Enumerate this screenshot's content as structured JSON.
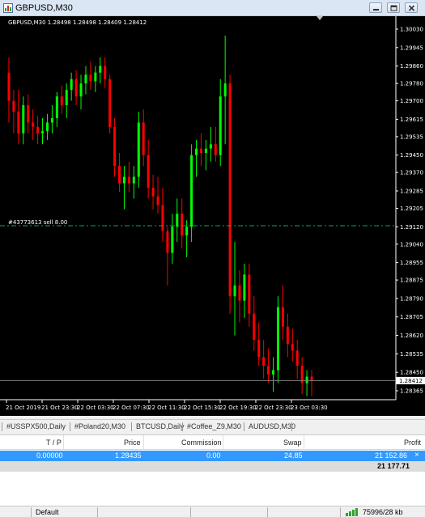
{
  "window": {
    "title": "GBPUSD,M30",
    "colors": {
      "bull": "#00ff00",
      "bear": "#ff0000",
      "background": "#000000",
      "order_line": "#00b050"
    }
  },
  "chart": {
    "info": "GBPUSD,M30  1.28498 1.28498 1.28409 1.28412",
    "order_label": "#43773613 sell 8.00",
    "current_price_label": "1.28412"
  },
  "chart_data": {
    "type": "candlestick",
    "symbol": "GBPUSD",
    "timeframe": "M30",
    "price_ticks": [
      "1.30030",
      "1.29945",
      "1.29860",
      "1.29780",
      "1.29700",
      "1.29615",
      "1.29535",
      "1.29450",
      "1.29370",
      "1.29285",
      "1.29205",
      "1.29120",
      "1.29040",
      "1.28955",
      "1.28875",
      "1.28790",
      "1.28705",
      "1.28620",
      "1.28535",
      "1.28450",
      "1.28365"
    ],
    "time_ticks": [
      "21 Oct 2019",
      "21 Oct 23:30",
      "22 Oct 03:30",
      "22 Oct 07:30",
      "22 Oct 11:30",
      "22 Oct 15:30",
      "22 Oct 19:30",
      "22 Oct 23:30",
      "23 Oct 03:30"
    ],
    "ylim": [
      1.28365,
      1.3003
    ],
    "order_price": 1.29125,
    "current_price": 1.28412,
    "candles": [
      {
        "o": 1.2983,
        "h": 1.299,
        "l": 1.296,
        "c": 1.297
      },
      {
        "o": 1.297,
        "h": 1.2975,
        "l": 1.2955,
        "c": 1.2965
      },
      {
        "o": 1.2965,
        "h": 1.2975,
        "l": 1.295,
        "c": 1.2955
      },
      {
        "o": 1.2955,
        "h": 1.2972,
        "l": 1.295,
        "c": 1.2968
      },
      {
        "o": 1.2968,
        "h": 1.2973,
        "l": 1.2955,
        "c": 1.296
      },
      {
        "o": 1.296,
        "h": 1.2966,
        "l": 1.2952,
        "c": 1.2958
      },
      {
        "o": 1.2958,
        "h": 1.2963,
        "l": 1.295,
        "c": 1.2955
      },
      {
        "o": 1.2955,
        "h": 1.2962,
        "l": 1.295,
        "c": 1.2956
      },
      {
        "o": 1.2956,
        "h": 1.2964,
        "l": 1.2952,
        "c": 1.296
      },
      {
        "o": 1.296,
        "h": 1.2968,
        "l": 1.2955,
        "c": 1.2962
      },
      {
        "o": 1.2962,
        "h": 1.2974,
        "l": 1.2958,
        "c": 1.2972
      },
      {
        "o": 1.2972,
        "h": 1.2977,
        "l": 1.2964,
        "c": 1.2968
      },
      {
        "o": 1.2968,
        "h": 1.2978,
        "l": 1.2962,
        "c": 1.2975
      },
      {
        "o": 1.2975,
        "h": 1.2983,
        "l": 1.297,
        "c": 1.298
      },
      {
        "o": 1.298,
        "h": 1.2984,
        "l": 1.2968,
        "c": 1.2972
      },
      {
        "o": 1.2972,
        "h": 1.2982,
        "l": 1.2966,
        "c": 1.2978
      },
      {
        "o": 1.2978,
        "h": 1.2986,
        "l": 1.2973,
        "c": 1.2982
      },
      {
        "o": 1.2982,
        "h": 1.2988,
        "l": 1.2975,
        "c": 1.2979
      },
      {
        "o": 1.2979,
        "h": 1.2986,
        "l": 1.2974,
        "c": 1.2983
      },
      {
        "o": 1.2983,
        "h": 1.299,
        "l": 1.2978,
        "c": 1.2986
      },
      {
        "o": 1.2986,
        "h": 1.299,
        "l": 1.2976,
        "c": 1.298
      },
      {
        "o": 1.298,
        "h": 1.2982,
        "l": 1.2955,
        "c": 1.2958
      },
      {
        "o": 1.2958,
        "h": 1.2962,
        "l": 1.2935,
        "c": 1.294
      },
      {
        "o": 1.294,
        "h": 1.2946,
        "l": 1.2928,
        "c": 1.2932
      },
      {
        "o": 1.2932,
        "h": 1.294,
        "l": 1.292,
        "c": 1.2935
      },
      {
        "o": 1.2935,
        "h": 1.2942,
        "l": 1.2928,
        "c": 1.2932
      },
      {
        "o": 1.2932,
        "h": 1.294,
        "l": 1.2925,
        "c": 1.2935
      },
      {
        "o": 1.2935,
        "h": 1.2965,
        "l": 1.293,
        "c": 1.296
      },
      {
        "o": 1.296,
        "h": 1.2966,
        "l": 1.294,
        "c": 1.2945
      },
      {
        "o": 1.2945,
        "h": 1.2952,
        "l": 1.2925,
        "c": 1.293
      },
      {
        "o": 1.293,
        "h": 1.2936,
        "l": 1.292,
        "c": 1.2926
      },
      {
        "o": 1.2926,
        "h": 1.2935,
        "l": 1.2918,
        "c": 1.2922
      },
      {
        "o": 1.2922,
        "h": 1.293,
        "l": 1.2905,
        "c": 1.291
      },
      {
        "o": 1.291,
        "h": 1.2912,
        "l": 1.2885,
        "c": 1.29
      },
      {
        "o": 1.29,
        "h": 1.2918,
        "l": 1.2895,
        "c": 1.2912
      },
      {
        "o": 1.2912,
        "h": 1.2925,
        "l": 1.2905,
        "c": 1.2918
      },
      {
        "o": 1.2918,
        "h": 1.2925,
        "l": 1.2902,
        "c": 1.2908
      },
      {
        "o": 1.2908,
        "h": 1.2915,
        "l": 1.2898,
        "c": 1.2912
      },
      {
        "o": 1.2912,
        "h": 1.295,
        "l": 1.2905,
        "c": 1.2945
      },
      {
        "o": 1.2945,
        "h": 1.2952,
        "l": 1.2935,
        "c": 1.2948
      },
      {
        "o": 1.2948,
        "h": 1.2955,
        "l": 1.294,
        "c": 1.2946
      },
      {
        "o": 1.2946,
        "h": 1.2952,
        "l": 1.2938,
        "c": 1.2948
      },
      {
        "o": 1.2948,
        "h": 1.2958,
        "l": 1.2942,
        "c": 1.295
      },
      {
        "o": 1.295,
        "h": 1.2958,
        "l": 1.2942,
        "c": 1.2945
      },
      {
        "o": 1.2945,
        "h": 1.298,
        "l": 1.294,
        "c": 1.2972
      },
      {
        "o": 1.2972,
        "h": 1.3,
        "l": 1.295,
        "c": 1.2978
      },
      {
        "o": 1.2978,
        "h": 1.2982,
        "l": 1.2872,
        "c": 1.288
      },
      {
        "o": 1.288,
        "h": 1.2905,
        "l": 1.2862,
        "c": 1.2885
      },
      {
        "o": 1.2885,
        "h": 1.2892,
        "l": 1.2868,
        "c": 1.2878
      },
      {
        "o": 1.2878,
        "h": 1.2895,
        "l": 1.287,
        "c": 1.289
      },
      {
        "o": 1.289,
        "h": 1.2895,
        "l": 1.2866,
        "c": 1.2872
      },
      {
        "o": 1.2872,
        "h": 1.288,
        "l": 1.2855,
        "c": 1.286
      },
      {
        "o": 1.286,
        "h": 1.2868,
        "l": 1.2848,
        "c": 1.2852
      },
      {
        "o": 1.2852,
        "h": 1.286,
        "l": 1.2842,
        "c": 1.2848
      },
      {
        "o": 1.2848,
        "h": 1.2856,
        "l": 1.284,
        "c": 1.2844
      },
      {
        "o": 1.2844,
        "h": 1.2852,
        "l": 1.2836,
        "c": 1.2846
      },
      {
        "o": 1.2846,
        "h": 1.288,
        "l": 1.284,
        "c": 1.2875
      },
      {
        "o": 1.2875,
        "h": 1.2885,
        "l": 1.286,
        "c": 1.2866
      },
      {
        "o": 1.2866,
        "h": 1.2872,
        "l": 1.2852,
        "c": 1.2858
      },
      {
        "o": 1.2858,
        "h": 1.2865,
        "l": 1.285,
        "c": 1.2855
      },
      {
        "o": 1.2855,
        "h": 1.286,
        "l": 1.2842,
        "c": 1.2848
      },
      {
        "o": 1.2848,
        "h": 1.2852,
        "l": 1.2835,
        "c": 1.284
      },
      {
        "o": 1.284,
        "h": 1.2846,
        "l": 1.2834,
        "c": 1.2843
      },
      {
        "o": 1.2843,
        "h": 1.2846,
        "l": 1.2834,
        "c": 1.2841
      }
    ]
  },
  "tabs": [
    "#USSPX500,Daily",
    "#Poland20,M30",
    "BTCUSD,Daily",
    "#Coffee_Z9,M30",
    "AUDUSD,M30"
  ],
  "terminal": {
    "columns": [
      "T / P",
      "Price",
      "Commission",
      "Swap",
      "Profit"
    ],
    "row": {
      "tp": "0.00000",
      "price": "1.28435",
      "commission": "0.00",
      "swap": "24.85",
      "profit": "21 152.86"
    },
    "total": "21 177.71"
  },
  "status": {
    "profile": "Default",
    "traffic": "75996/28 kb"
  }
}
